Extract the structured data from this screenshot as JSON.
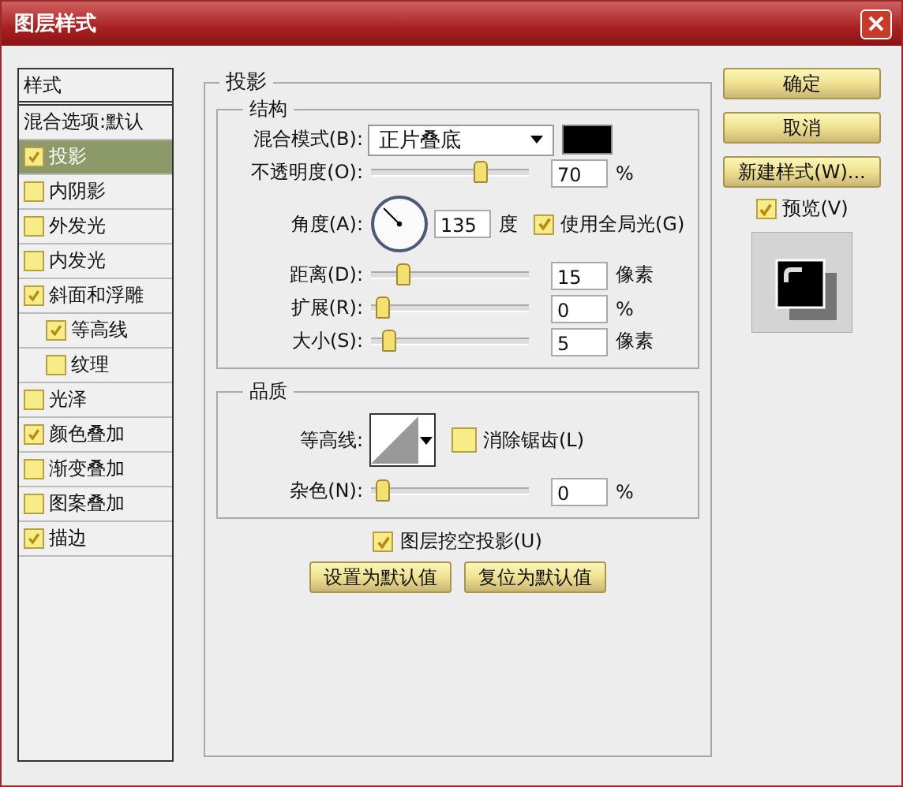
{
  "window": {
    "title": "图层样式"
  },
  "styles": {
    "header": "样式",
    "items": [
      {
        "label": "混合选项:默认",
        "kind": "option",
        "selected": false
      },
      {
        "label": "投影",
        "kind": "effect",
        "checked": true,
        "selected": true
      },
      {
        "label": "内阴影",
        "kind": "effect",
        "checked": false,
        "selected": false
      },
      {
        "label": "外发光",
        "kind": "effect",
        "checked": false,
        "selected": false
      },
      {
        "label": "内发光",
        "kind": "effect",
        "checked": false,
        "selected": false
      },
      {
        "label": "斜面和浮雕",
        "kind": "effect",
        "checked": true,
        "selected": false,
        "children": [
          {
            "label": "等高线",
            "kind": "effect",
            "checked": true,
            "selected": false
          },
          {
            "label": "纹理",
            "kind": "effect",
            "checked": false,
            "selected": false
          }
        ]
      },
      {
        "label": "光泽",
        "kind": "effect",
        "checked": false,
        "selected": false
      },
      {
        "label": "颜色叠加",
        "kind": "effect",
        "checked": true,
        "selected": false
      },
      {
        "label": "渐变叠加",
        "kind": "effect",
        "checked": false,
        "selected": false
      },
      {
        "label": "图案叠加",
        "kind": "effect",
        "checked": false,
        "selected": false
      },
      {
        "label": "描边",
        "kind": "effect",
        "checked": true,
        "selected": false
      }
    ]
  },
  "drop_shadow": {
    "title": "投影",
    "structure": {
      "title": "结构",
      "blend_mode": {
        "label": "混合模式(B):",
        "value": "正片叠底",
        "color": "#000000"
      },
      "rows": [
        {
          "kind": "slider",
          "label": "不透明度(O):",
          "level": 0.7,
          "value": "70",
          "unit": "%"
        },
        {
          "kind": "angle",
          "label": "角度(A):",
          "value": "135",
          "unit": "度",
          "checkbox": {
            "label": "使用全局光(G)",
            "checked": true
          }
        },
        {
          "kind": "slider",
          "label": "距离(D):",
          "level": 0.15,
          "value": "15",
          "unit": "像素"
        },
        {
          "kind": "slider",
          "label": "扩展(R):",
          "level": 0,
          "value": "0",
          "unit": "%"
        },
        {
          "kind": "slider",
          "label": "大小(S):",
          "level": 0.05,
          "value": "5",
          "unit": "像素"
        }
      ]
    },
    "quality": {
      "title": "品质",
      "contour": {
        "label": "等高线:",
        "checkbox": {
          "label": "消除锯齿(L)",
          "checked": false
        }
      },
      "noise": {
        "label": "杂色(N):",
        "level": 0,
        "value": "0",
        "unit": "%"
      }
    },
    "knockout": {
      "label": "图层挖空投影(U)",
      "checked": true
    },
    "buttons": [
      "设置为默认值",
      "复位为默认值"
    ]
  },
  "actions": {
    "buttons": [
      "确定",
      "取消",
      "新建样式(W)..."
    ],
    "preview": {
      "label": "预览(V)",
      "checked": true
    }
  }
}
